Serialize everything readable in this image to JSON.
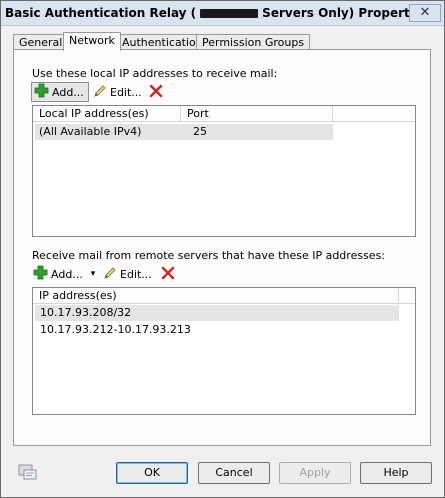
{
  "window": {
    "title_prefix": "Basic Authentication Relay (",
    "title_suffix": "Servers Only) Properties",
    "close_glyph": "✕"
  },
  "tabs": [
    {
      "label": "General"
    },
    {
      "label": "Network"
    },
    {
      "label": "Authentication"
    },
    {
      "label": "Permission Groups"
    }
  ],
  "local": {
    "section_label": "Use these local IP addresses to receive mail:",
    "add_label": "Add...",
    "edit_label": "Edit...",
    "columns": [
      "Local IP address(es)",
      "Port"
    ],
    "rows": [
      {
        "ip": "(All Available IPv4)",
        "port": "25"
      }
    ]
  },
  "remote": {
    "section_label": "Receive mail from remote servers that have these IP addresses:",
    "add_label": "Add...",
    "edit_label": "Edit...",
    "dropdown_glyph": "▾",
    "columns": [
      "IP address(es)"
    ],
    "rows": [
      {
        "ip": "10.17.93.208/32"
      },
      {
        "ip": "10.17.93.212-10.17.93.213"
      }
    ]
  },
  "buttons": {
    "ok": "OK",
    "cancel": "Cancel",
    "apply": "Apply",
    "help": "Help"
  },
  "colors": {
    "add_icon": "#2e9e2e",
    "delete_icon": "#d42020",
    "selected_row": "#e4e4e4"
  }
}
